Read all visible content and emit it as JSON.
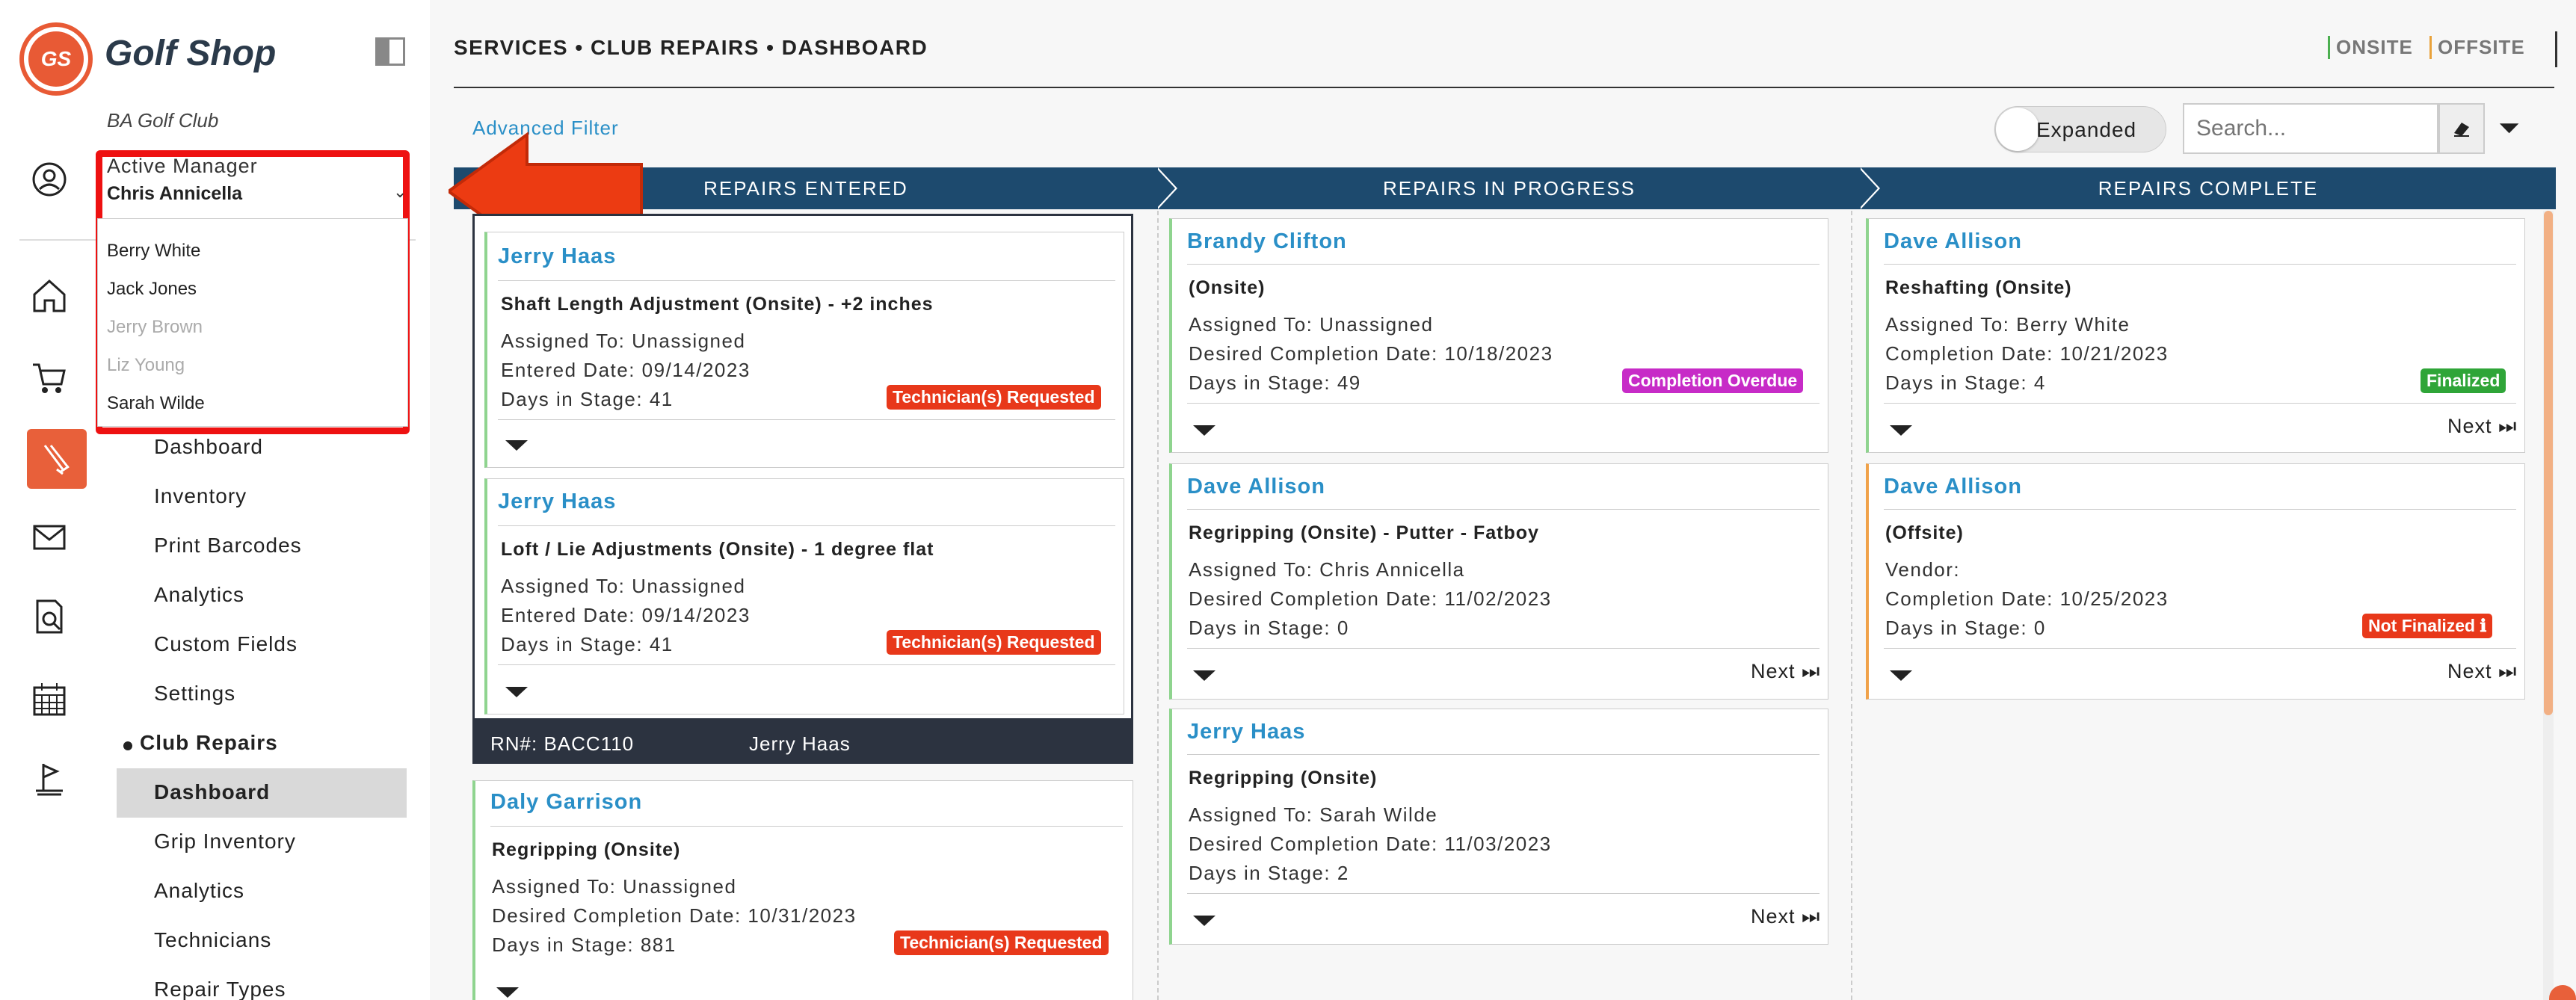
{
  "brand": {
    "logo_text": "GS",
    "name": "Golf Shop",
    "club": "BA Golf Club"
  },
  "active_manager": {
    "label": "Active Manager",
    "value": "Chris Annicella",
    "options": [
      "Berry White",
      "Jack Jones",
      "Jerry Brown",
      "Liz Young",
      "Sarah Wilde"
    ],
    "disabled_options": [
      "Jerry Brown",
      "Liz Young"
    ]
  },
  "sidebar": {
    "rail_icons": [
      "user-icon",
      "home-icon",
      "cart-icon",
      "golf-clubs-icon",
      "mail-icon",
      "search-document-icon",
      "calendar-icon",
      "flag-icon"
    ],
    "nav": [
      "Dashboard",
      "Inventory",
      "Print Barcodes",
      "Analytics",
      "Custom Fields",
      "Settings"
    ],
    "section": "Club Repairs",
    "section_items": [
      "Dashboard",
      "Grip Inventory",
      "Analytics",
      "Technicians",
      "Repair Types"
    ],
    "active_item": "Dashboard"
  },
  "header": {
    "breadcrumb": "SERVICES • CLUB REPAIRS • DASHBOARD",
    "onsite": "ONSITE",
    "offsite": "OFFSITE",
    "advanced_filter": "Advanced Filter",
    "toggle_label": "Expanded",
    "search_placeholder": "Search..."
  },
  "columns": {
    "entered": "REPAIRS ENTERED",
    "progress": "REPAIRS IN PROGRESS",
    "complete": "REPAIRS COMPLETE"
  },
  "cards": {
    "entered": [
      {
        "name": "Jerry Haas",
        "title": "Shaft Length Adjustment (Onsite) - +2 inches",
        "lines": [
          "Assigned To: Unassigned",
          "Entered Date: 09/14/2023",
          "Days in Stage: 41"
        ],
        "badge": "Technician(s) Requested"
      },
      {
        "name": "Jerry Haas",
        "title": "Loft / Lie Adjustments (Onsite) - 1 degree flat",
        "lines": [
          "Assigned To: Unassigned",
          "Entered Date: 09/14/2023",
          "Days in Stage: 41"
        ],
        "badge": "Technician(s) Requested"
      },
      {
        "name": "Daly Garrison",
        "title": "Regripping (Onsite)",
        "lines": [
          "Assigned To: Unassigned",
          "Desired Completion Date: 10/31/2023",
          "Days in Stage: 881"
        ],
        "badge": "Technician(s) Requested"
      }
    ],
    "rn_bar": {
      "rn": "RN#: BACC110",
      "customer": "Jerry Haas"
    },
    "progress": [
      {
        "name": "Brandy Clifton",
        "title": "(Onsite)",
        "lines": [
          "Assigned To: Unassigned",
          "Desired Completion Date: 10/18/2023",
          "Days in Stage: 49"
        ],
        "badge": "Completion Overdue",
        "next": ""
      },
      {
        "name": "Dave Allison",
        "title": "Regripping (Onsite) - Putter - Fatboy",
        "lines": [
          "Assigned To: Chris Annicella",
          "Desired Completion Date: 11/02/2023",
          "Days in Stage: 0"
        ],
        "badge": "",
        "next": "Next"
      },
      {
        "name": "Jerry Haas",
        "title": "Regripping (Onsite)",
        "lines": [
          "Assigned To: Sarah Wilde",
          "Desired Completion Date: 11/03/2023",
          "Days in Stage: 2"
        ],
        "badge": "",
        "next": "Next"
      }
    ],
    "complete": [
      {
        "name": "Dave Allison",
        "title": "Reshafting (Onsite)",
        "lines": [
          "Assigned To: Berry White",
          "Completion Date: 10/21/2023",
          "Days in Stage: 4"
        ],
        "badge": "Finalized",
        "next": "Next"
      },
      {
        "name": "Dave Allison",
        "title": "(Offsite)",
        "lines": [
          "Vendor:",
          "Completion Date: 10/25/2023",
          "Days in Stage: 0"
        ],
        "badge": "Not Finalized ℹ",
        "next": "Next"
      }
    ]
  },
  "colors": {
    "accent": "#2a8fc7",
    "header": "#1d4a6e",
    "brand": "#e85a35",
    "highlight": "#e11111"
  }
}
